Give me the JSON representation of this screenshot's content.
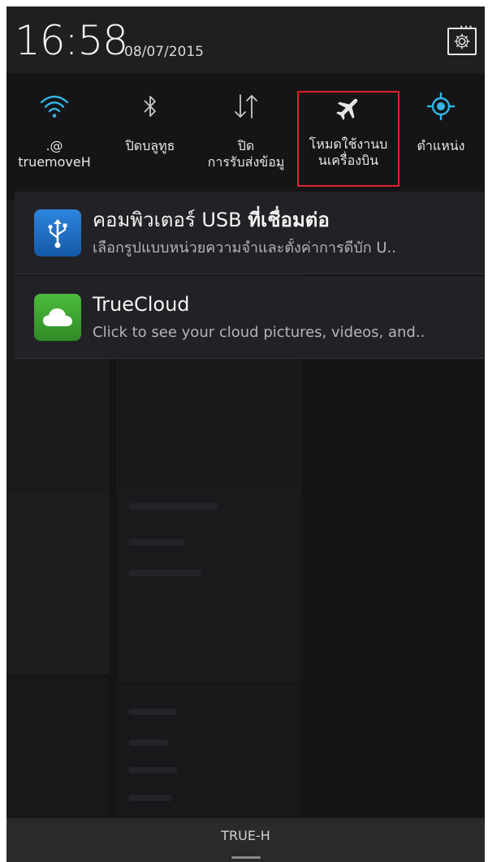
{
  "status": {
    "time": "16:58",
    "date": "08/07/2015",
    "settings_icon": "gear-icon"
  },
  "quick_settings": [
    {
      "id": "wifi",
      "icon": "wifi-icon",
      "label": ".@\ntruemoveH",
      "active": true
    },
    {
      "id": "bluetooth",
      "icon": "bluetooth-icon",
      "label": "ปิดบลูทูธ",
      "active": false
    },
    {
      "id": "data",
      "icon": "data-transfer-icon",
      "label": "ปิด\nการรับส่งข้อมู",
      "active": false
    },
    {
      "id": "airplane",
      "icon": "airplane-icon",
      "label": "โหมดใช้งานบ\nนเครื่องบิน",
      "active": false
    },
    {
      "id": "location",
      "icon": "location-icon",
      "label": "ตำแหน่ง",
      "active": true
    }
  ],
  "notifications": [
    {
      "icon": "usb-icon",
      "title_regular": "คอมพิวเตอร์",
      "title_mid": " USB ",
      "title_bold": "ที่เชื่อมต่อ",
      "subtitle": "เลือกรูปแบบหน่วยความจำและตั้งค่าการดีบัก U..",
      "icon_color": "#1f6fc4"
    },
    {
      "icon": "cloud-icon",
      "title": "TrueCloud",
      "subtitle": "Click to see your cloud pictures, videos, and..",
      "icon_color": "#3aa334"
    }
  ],
  "carrier": {
    "name": "TRUE-H"
  },
  "colors": {
    "accent": "#33b5e5",
    "highlight_box": "#e0202a"
  }
}
